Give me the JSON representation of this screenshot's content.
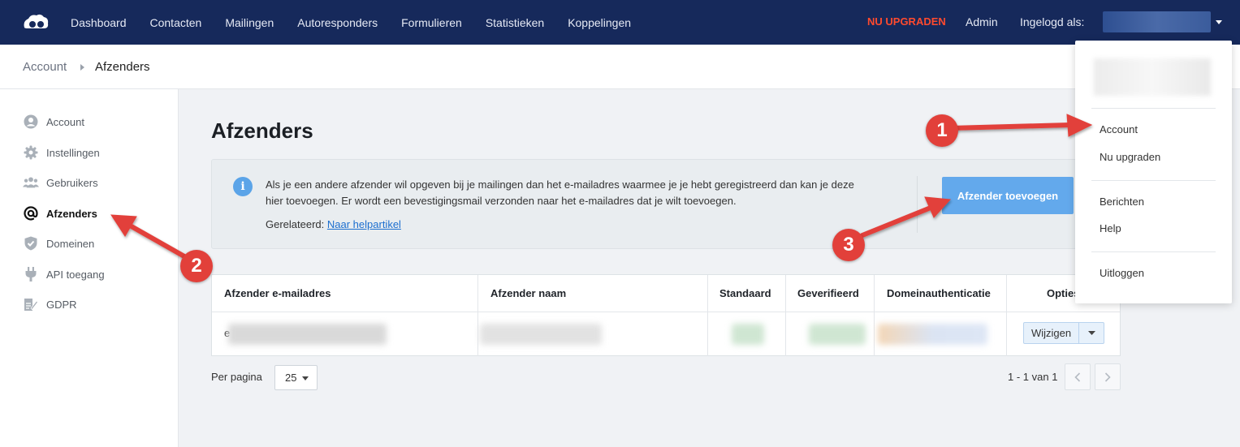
{
  "nav": {
    "items": [
      "Dashboard",
      "Contacten",
      "Mailingen",
      "Autoresponders",
      "Formulieren",
      "Statistieken",
      "Koppelingen"
    ],
    "upgrade": "NU UPGRADEN",
    "admin": "Admin",
    "logged_in": "Ingelogd als:"
  },
  "breadcrumb": {
    "parent": "Account",
    "current": "Afzenders"
  },
  "sidebar": {
    "items": [
      {
        "label": "Account",
        "icon": "user-circle-icon"
      },
      {
        "label": "Instellingen",
        "icon": "gear-icon"
      },
      {
        "label": "Gebruikers",
        "icon": "users-icon"
      },
      {
        "label": "Afzenders",
        "icon": "at-sign-icon",
        "active": true
      },
      {
        "label": "Domeinen",
        "icon": "shield-check-icon"
      },
      {
        "label": "API toegang",
        "icon": "plug-icon"
      },
      {
        "label": "GDPR",
        "icon": "document-pen-icon"
      }
    ]
  },
  "main": {
    "title": "Afzenders",
    "info_line1": "Als je een andere afzender wil opgeven bij je mailingen dan het e-mailadres waarmee je je hebt geregistreerd dan kan je deze",
    "info_line2": "hier toevoegen. Er wordt een bevestigingsmail verzonden naar het e-mailadres dat je wilt toevoegen.",
    "related_label": "Gerelateerd:",
    "related_link": "Naar helpartikel",
    "add_button": "Afzender toevoegen"
  },
  "table": {
    "headers": [
      "Afzender e-mailadres",
      "Afzender naam",
      "Standaard",
      "Geverifieerd",
      "Domeinauthenticatie",
      "Opties"
    ],
    "row_first_char": "e",
    "edit_label": "Wijzigen"
  },
  "pagination": {
    "per_page_label": "Per pagina",
    "per_page_value": "25",
    "range": "1 - 1 van 1"
  },
  "dropdown": {
    "items": [
      "Account",
      "Nu upgraden",
      "Berichten",
      "Help",
      "Uitloggen"
    ]
  },
  "annotations": {
    "badges": [
      "1",
      "2",
      "3"
    ]
  },
  "colors": {
    "nav_bg": "#16295b",
    "accent": "#63a9ec",
    "upgrade": "#ff4a2e",
    "annotation": "#e2403a"
  }
}
